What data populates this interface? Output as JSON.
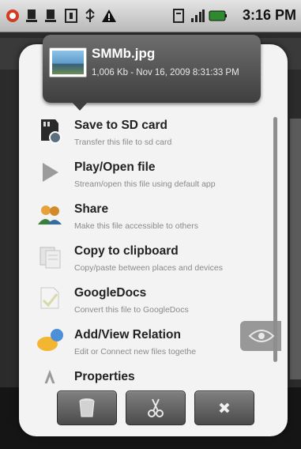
{
  "status_bar": {
    "time": "3:16 PM",
    "icons": [
      "notification-icon",
      "usb-debug-icon",
      "usb-debug-icon",
      "sim-slot-icon",
      "usb-connected-icon",
      "warning-icon",
      "storage-icon",
      "signal-icon",
      "battery-icon"
    ]
  },
  "dialog": {
    "file": {
      "name": "SMMb.jpg",
      "meta": "1,006 Kb - Nov 16, 2009 8:31:33 PM"
    },
    "menu": [
      {
        "title": "Save to SD card",
        "subtitle": "Transfer this file to sd card"
      },
      {
        "title": "Play/Open file",
        "subtitle": "Stream/open this file using default app"
      },
      {
        "title": "Share",
        "subtitle": "Make this file accessible to others"
      },
      {
        "title": "Copy to clipboard",
        "subtitle": "Copy/paste between places and devices"
      },
      {
        "title": "GoogleDocs",
        "subtitle": "Convert this file to GoogleDocs"
      },
      {
        "title": "Add/View Relation",
        "subtitle": "Edit or Connect new files togethe"
      },
      {
        "title": "Properties",
        "subtitle": ""
      }
    ],
    "buttons": [
      "delete-icon",
      "cut-icon",
      "close-icon"
    ]
  },
  "colors": {
    "dialog_bg": "#f3f3f3",
    "header_bg": "#4f4f4f",
    "button_bg": "#5f5f5f",
    "title_text": "#222222",
    "subtitle_text": "#8a8a8a"
  }
}
